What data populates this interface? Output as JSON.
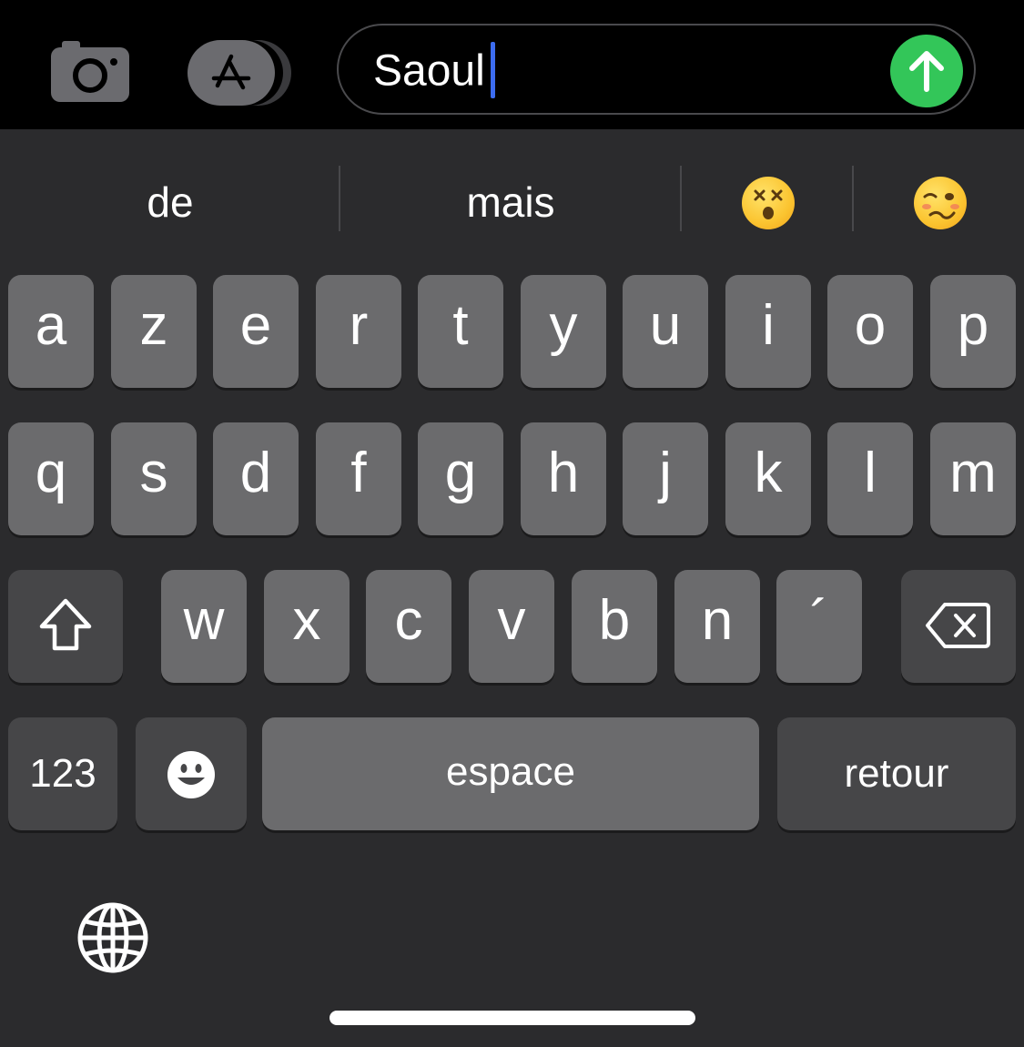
{
  "message": {
    "text": "Saoul",
    "send_icon": "arrow-up-icon"
  },
  "toolbar": {
    "camera_icon": "camera-icon",
    "apps_icon": "app-store-icon"
  },
  "suggestions": {
    "word1": "de",
    "word2": "mais",
    "emoji1": "dizzy-face-emoji",
    "emoji2": "woozy-face-emoji"
  },
  "keyboard": {
    "row1": [
      "a",
      "z",
      "e",
      "r",
      "t",
      "y",
      "u",
      "i",
      "o",
      "p"
    ],
    "row2": [
      "q",
      "s",
      "d",
      "f",
      "g",
      "h",
      "j",
      "k",
      "l",
      "m"
    ],
    "row3": [
      "w",
      "x",
      "c",
      "v",
      "b",
      "n",
      "´"
    ],
    "numbers_label": "123",
    "space_label": "espace",
    "return_label": "retour",
    "shift_icon": "shift-icon",
    "delete_icon": "backspace-icon",
    "emoji_icon": "emoji-icon",
    "globe_icon": "globe-icon"
  },
  "colors": {
    "send": "#33c659",
    "caret": "#3c6cf0",
    "key": "#6b6b6d",
    "fn_key": "#464648",
    "keyboard_bg": "#2b2b2d"
  }
}
